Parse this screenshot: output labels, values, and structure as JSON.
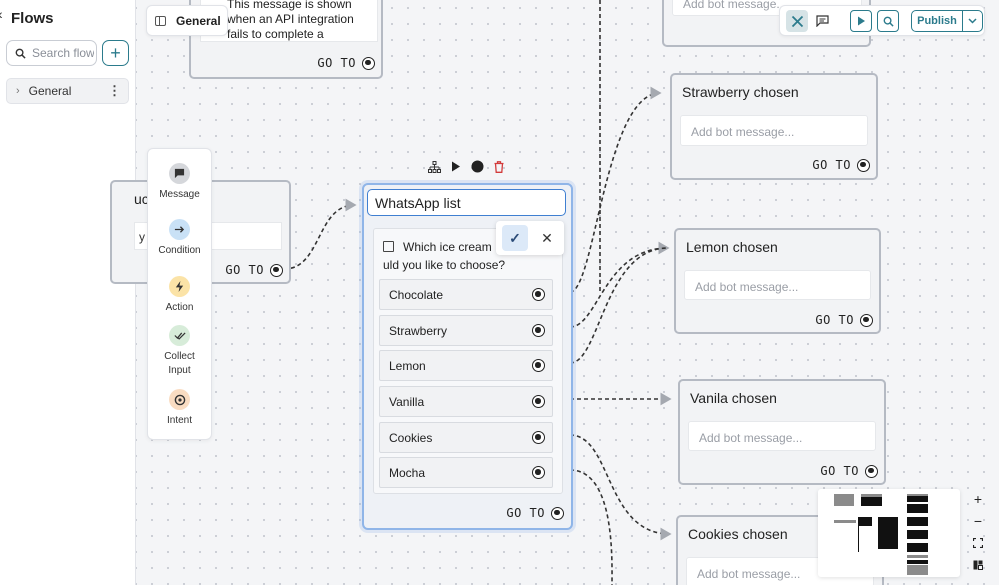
{
  "sidebar": {
    "title": "Flows",
    "search_placeholder": "Search flows",
    "add_button": "+",
    "items": [
      {
        "label": "General"
      }
    ]
  },
  "canvas_tab": {
    "label": "General"
  },
  "toolbar": {
    "publish_label": "Publish"
  },
  "nodes": {
    "error_message": {
      "text": "This message is shown when an API integration fails to complete a request. Tip: ...",
      "goto": "GO TO"
    },
    "left_partial": {
      "title": "uc",
      "input": "y t",
      "goto": "GO TO"
    },
    "top_right": {
      "input": "Add bot message..."
    },
    "strawberry": {
      "title": "Strawberry chosen",
      "input": "Add bot message...",
      "goto": "GO TO"
    },
    "lemon": {
      "title": "Lemon chosen",
      "input": "Add bot message...",
      "goto": "GO TO"
    },
    "vanilla": {
      "title": "Vanila chosen",
      "input": "Add bot message...",
      "goto": "GO TO"
    },
    "cookies": {
      "title": "Cookies chosen",
      "input": "Add bot message..."
    }
  },
  "palette": [
    {
      "label": "Message",
      "icon": "message-icon",
      "color": "#d5d7db"
    },
    {
      "label": "Condition",
      "icon": "arrow-right-icon",
      "color": "#c9e1f6"
    },
    {
      "label": "Action",
      "icon": "lightning-icon",
      "color": "#fbe3a7"
    },
    {
      "label": "Collect Input",
      "icon": "double-check-icon",
      "color": "#d7ecd9"
    },
    {
      "label": "Intent",
      "icon": "target-icon",
      "color": "#f9dcc2"
    }
  ],
  "whatsapp": {
    "title": "WhatsApp list",
    "question_line1": "Which ice cream",
    "question_line2": "uld you like to choose?",
    "options": [
      "Chocolate",
      "Strawberry",
      "Lemon",
      "Vanilla",
      "Cookies",
      "Mocha"
    ],
    "goto": "GO TO"
  },
  "zoom": {
    "in": "+",
    "out": "−"
  },
  "colors": {
    "accent": "#2b7b8c",
    "selected_border": "#3f7fd1"
  }
}
